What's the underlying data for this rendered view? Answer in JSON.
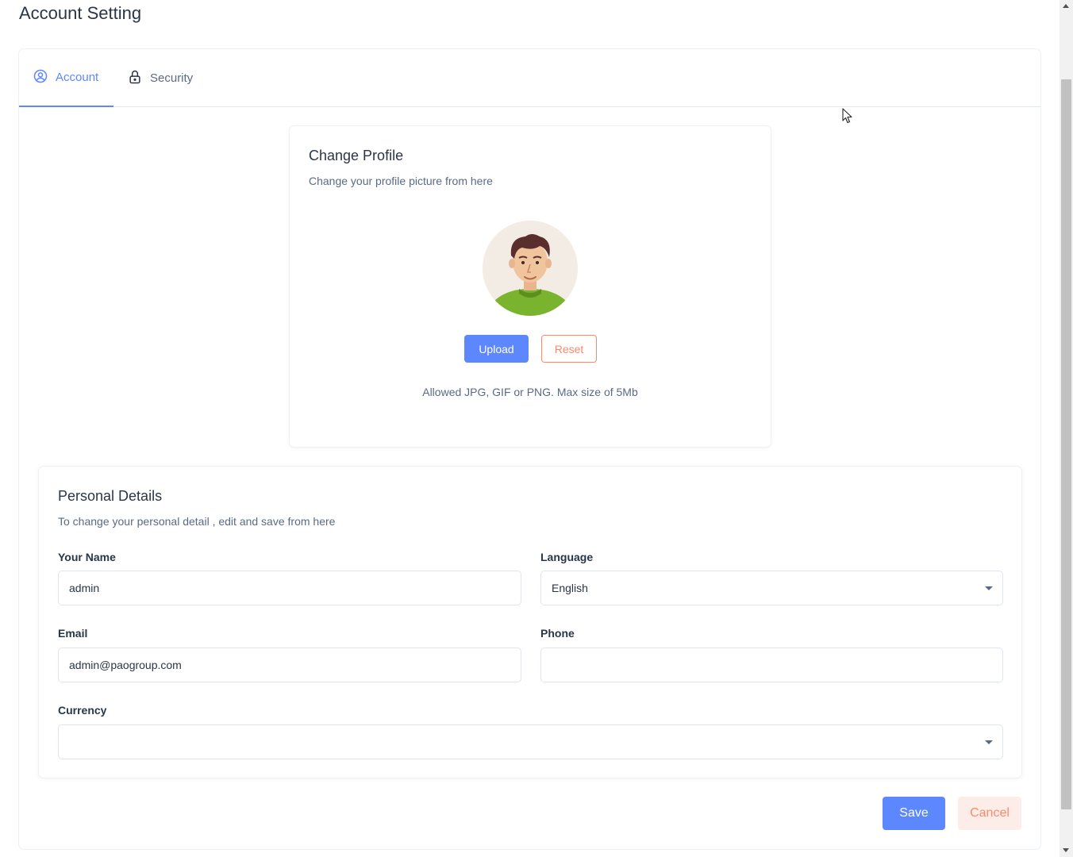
{
  "page": {
    "title": "Account Setting"
  },
  "tabs": [
    {
      "label": "Account",
      "icon": "user-circle-icon",
      "active": true
    },
    {
      "label": "Security",
      "icon": "lock-icon",
      "active": false
    }
  ],
  "profile": {
    "title": "Change Profile",
    "subtitle": "Change your profile picture from here",
    "upload_label": "Upload",
    "reset_label": "Reset",
    "hint": "Allowed JPG, GIF or PNG. Max size of 5Mb"
  },
  "details": {
    "title": "Personal Details",
    "subtitle": "To change your personal detail , edit and save from here",
    "name": {
      "label": "Your Name",
      "value": "admin"
    },
    "language": {
      "label": "Language",
      "value": "English"
    },
    "email": {
      "label": "Email",
      "value": "admin@paogroup.com"
    },
    "phone": {
      "label": "Phone",
      "value": ""
    },
    "currency": {
      "label": "Currency",
      "value": ""
    }
  },
  "actions": {
    "save_label": "Save",
    "cancel_label": "Cancel"
  },
  "colors": {
    "primary": "#5d87ff",
    "error": "#fa896b",
    "error_light": "#fdede8",
    "text": "#2a3547",
    "muted": "#5a6a85"
  }
}
